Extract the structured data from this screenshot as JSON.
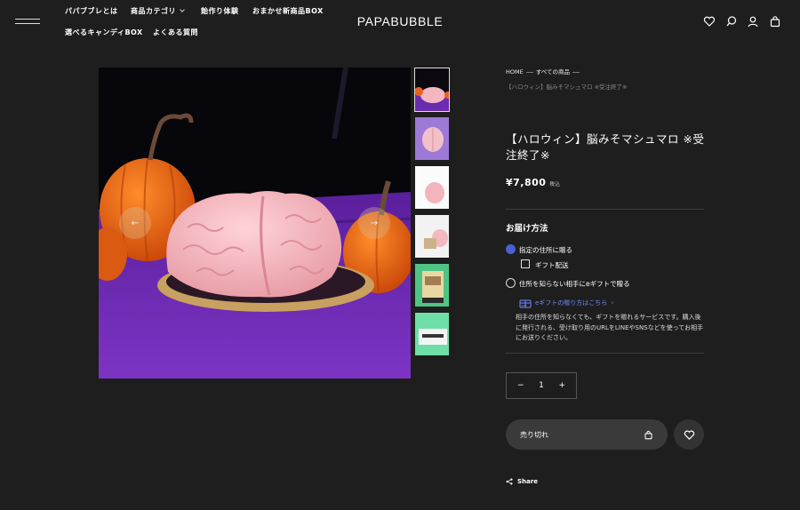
{
  "header": {
    "logo": "PAPABUBBLE",
    "nav": [
      "パパブブレとは",
      "商品カテゴリ",
      "飴作り体験",
      "おまかせ新商品BOX",
      "選べるキャンディBOX",
      "よくある質問"
    ]
  },
  "breadcrumb": {
    "home": "HOME",
    "all": "すべての商品",
    "current": "【ハロウィン】脳みそマシュマロ ※受注終了※"
  },
  "product": {
    "title": "【ハロウィン】脳みそマシュマロ ※受注終了※",
    "price": "¥7,800",
    "tax_note": "税込"
  },
  "delivery": {
    "heading": "お届け方法",
    "option_address": "指定の住所に贈る",
    "gift_wrap": "ギフト配送",
    "option_egift": "住所を知らない相手にeギフトで贈る",
    "egift_link": "eギフトの贈り方はこちら",
    "egift_icon_text": "GIFT",
    "egift_desc": "相手の住所を知らなくても、ギフトを贈れるサービスです。購入後に発行される、受け取り用のURLをLINEやSNSなどを使ってお相手にお送りください。"
  },
  "quantity": {
    "minus": "−",
    "value": "1",
    "plus": "+"
  },
  "actions": {
    "cart_label": "売り切れ",
    "share": "Share"
  },
  "colors": {
    "background": "#1e1e1e",
    "accent": "#4a5fd1",
    "link": "#6c8dff",
    "button": "#3a3a3a"
  },
  "gallery": {
    "thumbnail_count": 6,
    "active_index": 0,
    "prev_arrow": "←",
    "next_arrow": "→"
  }
}
